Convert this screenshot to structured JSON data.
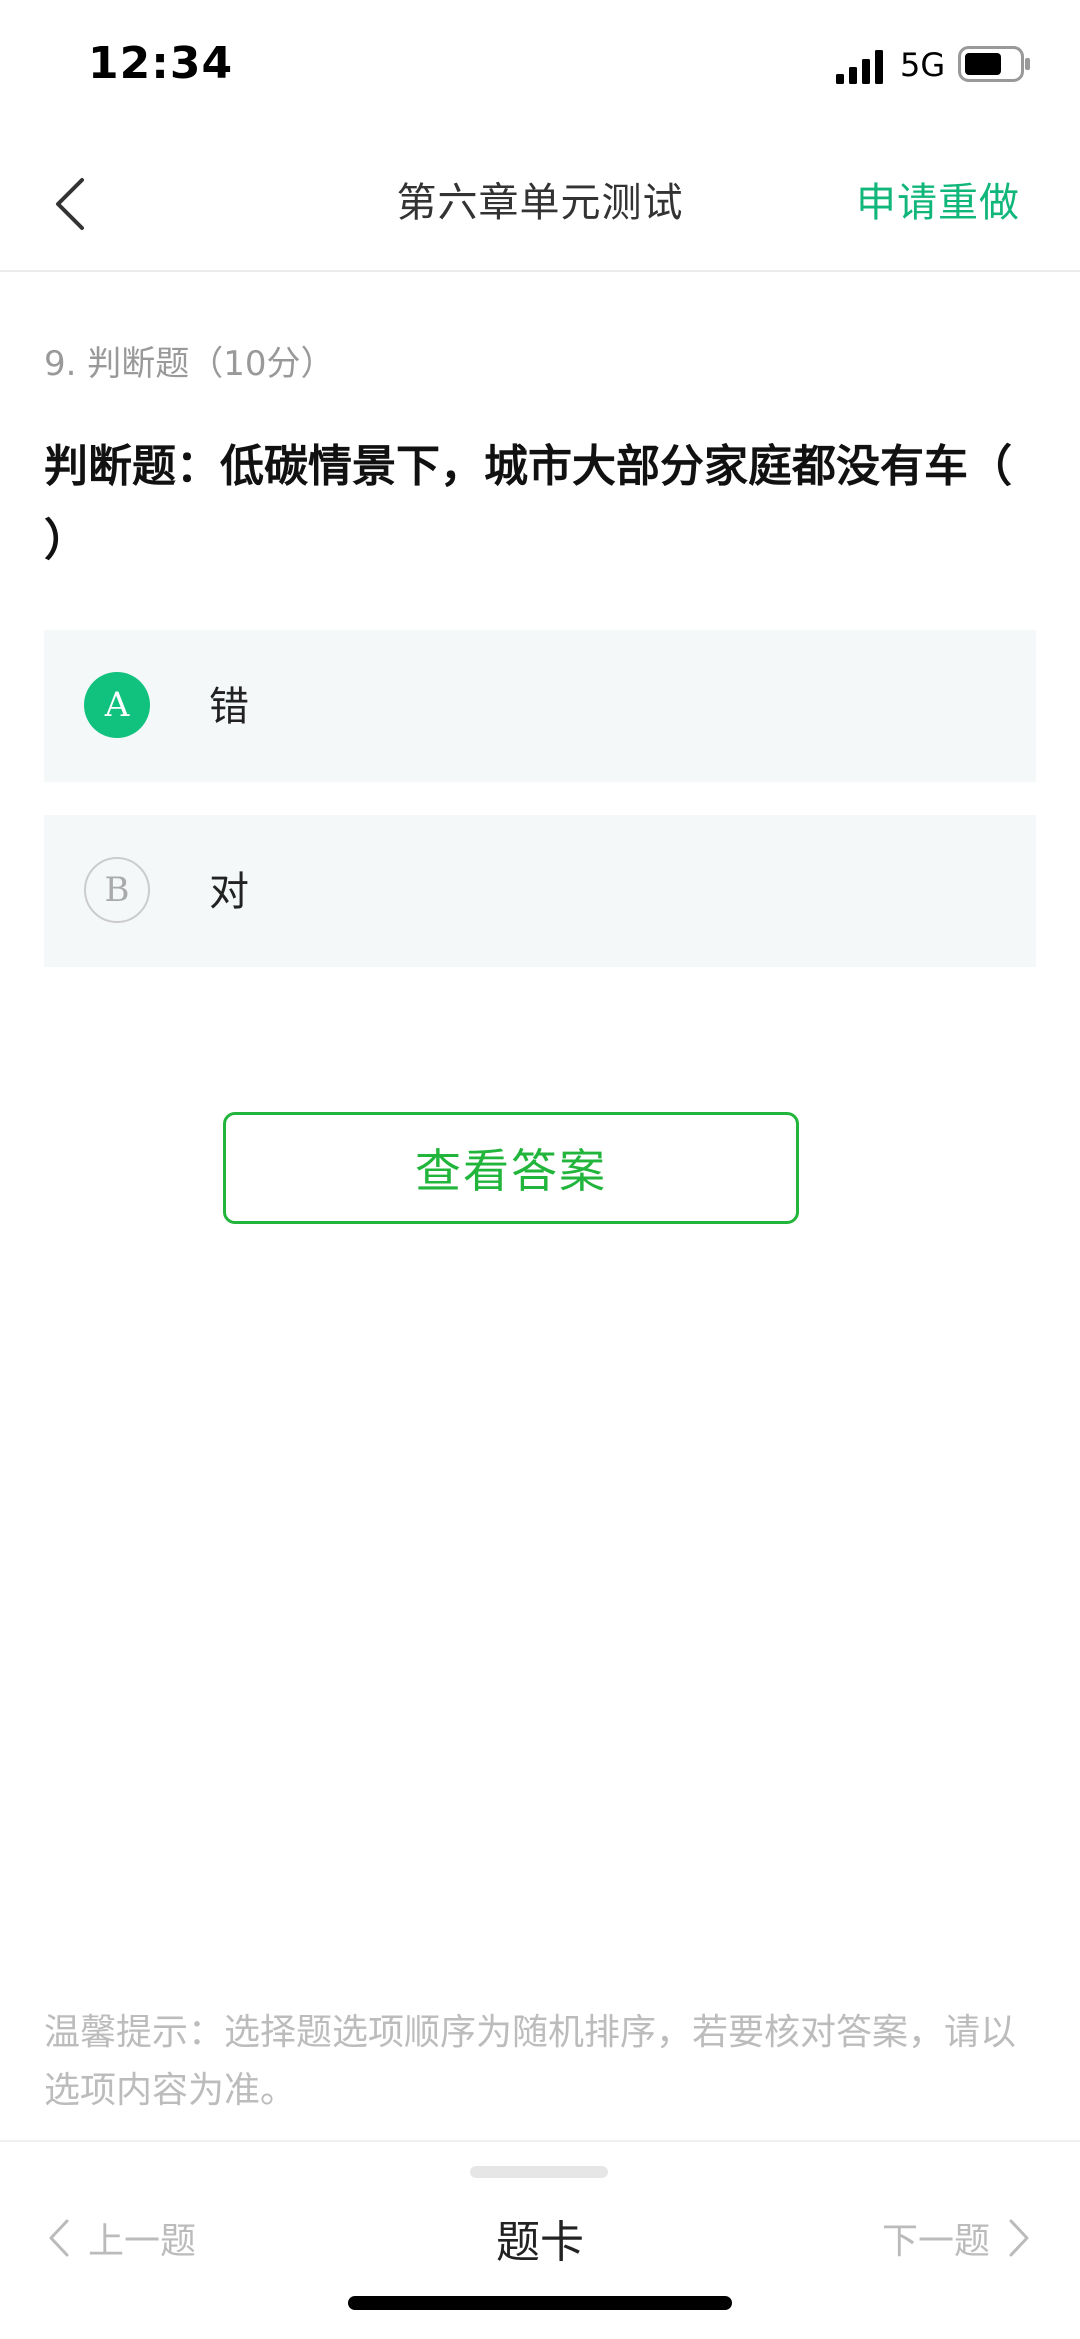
{
  "status_bar": {
    "time": "12:34",
    "network": "5G",
    "icons": [
      "signal-icon",
      "battery-icon"
    ]
  },
  "nav": {
    "title": "第六章单元测试",
    "redo": "申请重做",
    "back_icon": "chevron-left-icon"
  },
  "question": {
    "meta": "9. 判断题（10分）",
    "text": "判断题：低碳情景下，城市大部分家庭都没有车（ ）",
    "options": [
      {
        "letter": "A",
        "text": "错",
        "selected": true
      },
      {
        "letter": "B",
        "text": "对",
        "selected": false
      }
    ]
  },
  "view_answer": "查看答案",
  "tip": "温馨提示：选择题选项顺序为随机排序，若要核对答案，请以选项内容为准。",
  "bottom": {
    "prev": "上一题",
    "card": "题卡",
    "next": "下一题"
  },
  "colors": {
    "accent": "#11b77a",
    "button_green": "#22b53c",
    "option_bg": "#f4f8f9"
  }
}
